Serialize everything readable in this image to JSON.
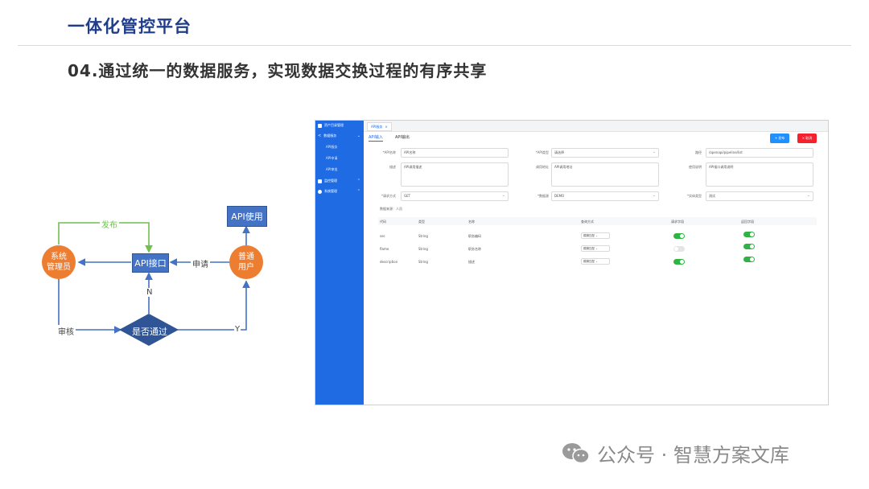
{
  "slide": {
    "title": "一体化管控平台",
    "subtitle": "04.通过统一的数据服务，实现数据交换过程的有序共享"
  },
  "flow": {
    "admin": "系统\n管理员",
    "user": "普通\n用户",
    "api_interface": "API接口",
    "api_use": "API使用",
    "decision": "是否通过",
    "publish": "发布",
    "apply": "申请",
    "review": "审核",
    "no": "N",
    "yes": "Y"
  },
  "app": {
    "sidebar": {
      "items": [
        {
          "label": "资产目录管理",
          "icon": "grid-icon"
        },
        {
          "label": "数据服务",
          "icon": "share-icon"
        },
        {
          "label": "API服务"
        },
        {
          "label": "API申请"
        },
        {
          "label": "API审批"
        },
        {
          "label": "监控管理",
          "icon": "monitor-icon"
        },
        {
          "label": "系统管理",
          "icon": "gear-icon"
        }
      ]
    },
    "tab": "API服务",
    "subtabs": [
      "API输入",
      "API输出"
    ],
    "buttons": {
      "publish": "+ 发布",
      "cancel": "× 取消"
    },
    "form": {
      "api_name_label": "*API名称",
      "api_name_value": "API名称",
      "api_type_label": "*API类型",
      "api_type_value": "请选择",
      "path_label": "路径",
      "path_value": "/openapi/pipeline/list",
      "desc_label": "描述",
      "desc_value": "API调用描述",
      "call_addr_label": "调用地址",
      "call_addr_value": "API调用地址",
      "use_desc_label": "使用说明",
      "use_desc_value": "API接口调用说明",
      "method_label": "*请求方式",
      "method_value": "GET",
      "source_label": "*数据源",
      "source_value": "DEMO",
      "entity_label": "*实体类型",
      "entity_value": "测试"
    },
    "data_source_text": "数据来源：人员",
    "table": {
      "headers": [
        "代码",
        "类型",
        "名称",
        "查询方式",
        "请求字段",
        "返回字段"
      ],
      "rows": [
        {
          "code": "sec",
          "type": "String",
          "name": "职务编码",
          "query": "模糊匹配",
          "req": true,
          "ret": true
        },
        {
          "code": "flame",
          "type": "String",
          "name": "职务名称",
          "query": "模糊匹配",
          "req": false,
          "ret": true
        },
        {
          "code": "description",
          "type": "String",
          "name": "描述",
          "query": "模糊匹配",
          "req": true,
          "ret": true
        }
      ]
    }
  },
  "watermark": "公众号 · 智慧方案文库"
}
